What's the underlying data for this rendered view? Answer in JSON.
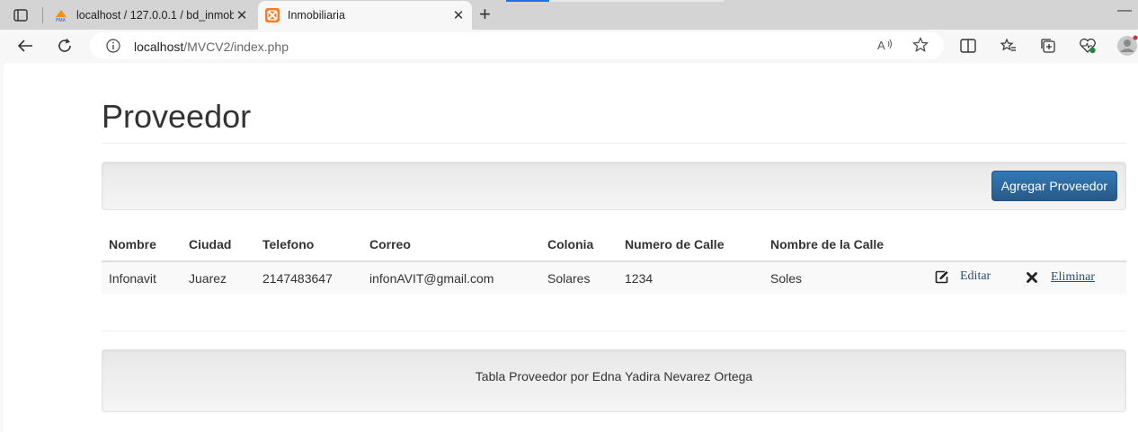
{
  "browser": {
    "tabs": [
      {
        "title": "localhost / 127.0.0.1 / bd_inmobi",
        "favicon": "phpmyadmin-icon",
        "active": false
      },
      {
        "title": "Inmobiliaria",
        "favicon": "xampp-icon",
        "active": true
      }
    ],
    "address": {
      "host": "localhost",
      "path": "/MVCV2/index.php"
    }
  },
  "page": {
    "title": "Proveedor",
    "add_button": "Agregar Proveedor",
    "table": {
      "headers": [
        "Nombre",
        "Ciudad",
        "Telefono",
        "Correo",
        "Colonia",
        "Numero de Calle",
        "Nombre de la Calle"
      ],
      "rows": [
        {
          "cells": [
            "Infonavit",
            "Juarez",
            "2147483647",
            "infonAVIT@gmail.com",
            "Solares",
            "1234",
            "Soles"
          ],
          "edit": "Editar",
          "delete": "Eliminar"
        }
      ]
    },
    "footer": "Tabla Proveedor por Edna Yadira Nevarez Ortega"
  },
  "colors": {
    "primary_button": "#2e6da4",
    "link": "#23527c"
  }
}
